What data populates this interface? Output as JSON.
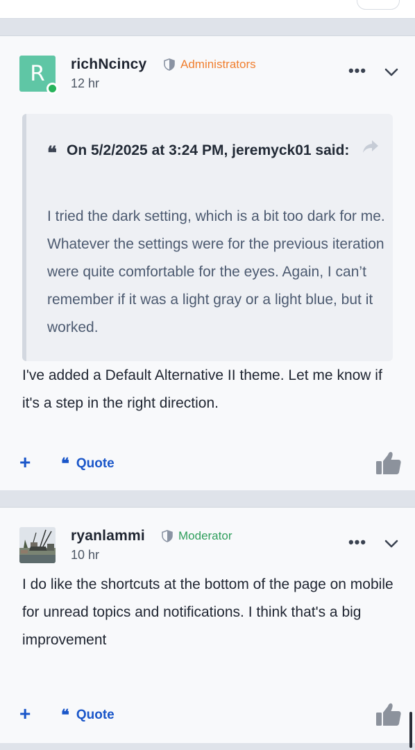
{
  "posts": [
    {
      "avatar_letter": "R",
      "username": "richNcincy",
      "role": "Administrators",
      "role_color": "#f07e2e",
      "time": "12 hr",
      "quote": {
        "header": "On 5/2/2025 at 3:24 PM, jeremyck01 said:",
        "body": "I tried the dark setting, which is a bit too dark for me. Whatever the settings were for the previous iteration were quite comfortable for the eyes. Again, I can’t remember if it was a light gray or a light blue, but it worked."
      },
      "text": "I've added a Default Alternative II theme. Let me know if it's a step in the right direction.",
      "actions": {
        "plus": "+",
        "quote_label": "Quote"
      }
    },
    {
      "username": "ryanlammi",
      "role": "Moderator",
      "role_color": "#2e9e5b",
      "time": "10 hr",
      "text": "I do like the shortcuts at the bottom of the page on mobile for unread topics and notifications. I think that's a big improvement",
      "actions": {
        "plus": "+",
        "quote_label": "Quote"
      }
    }
  ],
  "icons": {
    "role_badge": "shield-icon",
    "more": "more-options-icon",
    "expand": "chevron-down-icon",
    "quote": "quote-mark-icon",
    "share": "share-arrow-icon",
    "like": "thumbs-up-icon"
  },
  "colors": {
    "link": "#1a56c9",
    "online": "#27b35b",
    "avatar_bg": "#5fc6a5"
  }
}
